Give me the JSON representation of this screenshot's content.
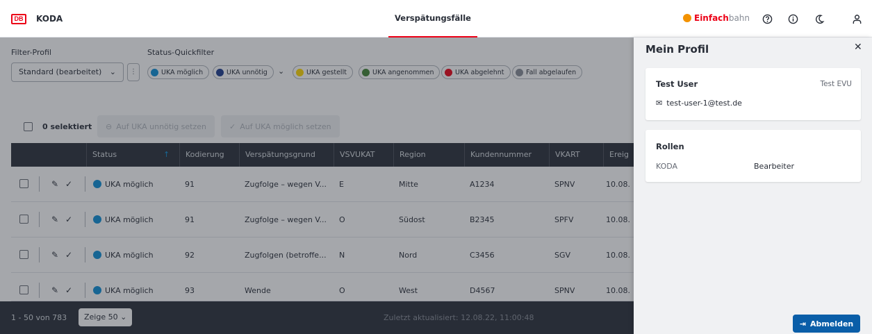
{
  "header": {
    "logo": "DB",
    "app_name": "KODA",
    "center_title": "Verspätungsfälle",
    "brand_part1": "Einfach",
    "brand_part2": "bahn",
    "icons": [
      "help-icon",
      "info-icon",
      "moon-icon",
      "user-icon"
    ]
  },
  "filter": {
    "profile_label": "Filter-Profil",
    "profile_value": "Standard (bearbeitet)",
    "quickfilter_label": "Status-Quickfilter",
    "chips": [
      {
        "label": "UKA möglich",
        "color": "#0c8dd6"
      },
      {
        "label": "UKA unnötig",
        "color": "#1d3b8e"
      },
      {
        "label": "UKA gestellt",
        "color": "#ffd800"
      },
      {
        "label": "UKA angenommen",
        "color": "#408335"
      },
      {
        "label": "UKA abgelehnt",
        "color": "#ec0016"
      },
      {
        "label": "Fall abgelaufen",
        "color": "#878c96"
      }
    ]
  },
  "toolbar": {
    "selected": "0 selektiert",
    "btn_unnoetig": "Auf UKA unnötig setzen",
    "btn_moeglich": "Auf UKA möglich setzen"
  },
  "table": {
    "headers": [
      "Status",
      "Kodierung",
      "Verspätungsgrund",
      "VSVUKAT",
      "Region",
      "Kundennummer",
      "VKART",
      "Ereig"
    ],
    "sort_indicator": "↑",
    "rows": [
      {
        "status": "UKA möglich",
        "kodierung": "91",
        "grund": "Zugfolge – wegen V...",
        "vsvukat": "E",
        "region": "Mitte",
        "kunde": "A1234",
        "vkart": "SPNV",
        "ereig": "10.08."
      },
      {
        "status": "UKA möglich",
        "kodierung": "91",
        "grund": "Zugfolge – wegen V...",
        "vsvukat": "O",
        "region": "Südost",
        "kunde": "B2345",
        "vkart": "SPFV",
        "ereig": "10.08."
      },
      {
        "status": "UKA möglich",
        "kodierung": "92",
        "grund": "Zugfolgen (betroffe...",
        "vsvukat": "N",
        "region": "Nord",
        "kunde": "C3456",
        "vkart": "SGV",
        "ereig": "10.08."
      },
      {
        "status": "UKA möglich",
        "kodierung": "93",
        "grund": "Wende",
        "vsvukat": "O",
        "region": "West",
        "kunde": "D4567",
        "vkart": "SPNV",
        "ereig": "10.08."
      }
    ]
  },
  "footer": {
    "count": "1 - 50 von 783",
    "page_size": "Zeige 50",
    "updated": "Zuletzt aktualisiert: 12.08.22, 11:00:48"
  },
  "drawer": {
    "title": "Mein Profil",
    "user_name": "Test User",
    "org": "Test EVU",
    "email": "test-user-1@test.de",
    "roles_title": "Rollen",
    "role_key": "KODA",
    "role_value": "Bearbeiter",
    "logout": "Abmelden"
  }
}
